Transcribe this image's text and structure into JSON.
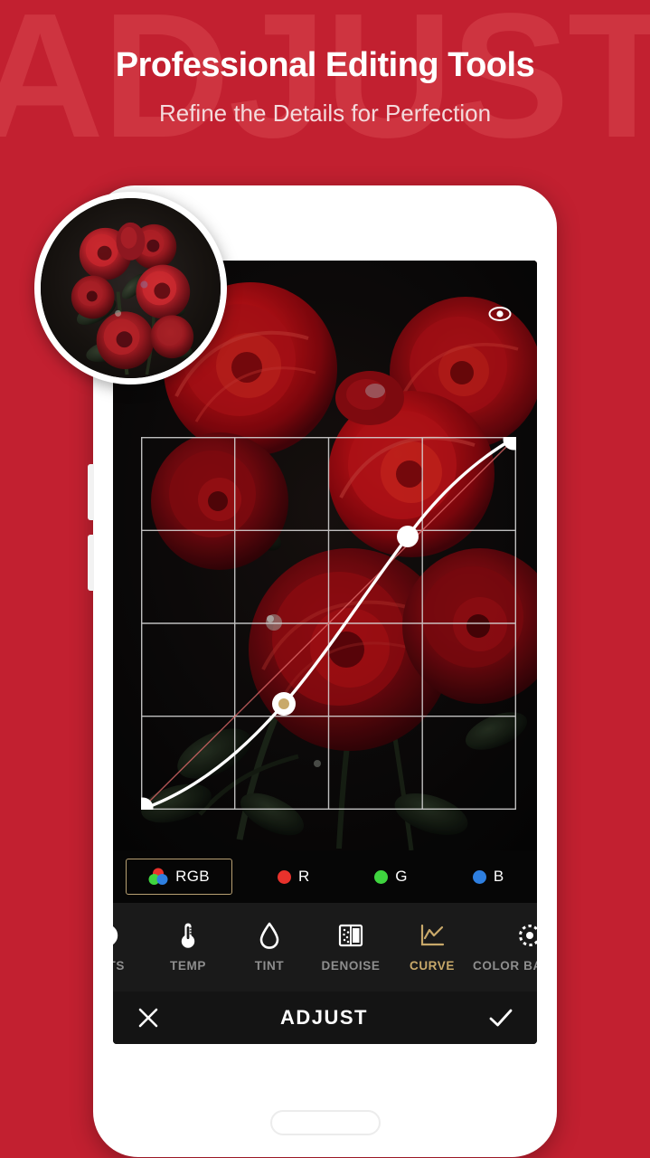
{
  "theme": {
    "brand_red": "#C22030",
    "watermark_red": "#CE3440",
    "accent_gold": "#C9A96A",
    "screen_black": "#0b0b0b",
    "bar_black": "#141414"
  },
  "header": {
    "watermark_text": "ADJUST",
    "title": "Professional Editing Tools",
    "subtitle": "Refine the Details for Perfection"
  },
  "phone": {
    "home_button": "home-button",
    "volume_up": "volume-up-button",
    "volume_down": "volume-down-button"
  },
  "thumbnail": {
    "alt": "original-photo-preview",
    "subject": "red roses bouquet on dark background"
  },
  "screen": {
    "preview_toggle_icon": "eye-icon",
    "photo_subject": "red roses bouquet on dark background"
  },
  "curve_editor": {
    "grid_rows": 4,
    "grid_columns": 4,
    "reference_line": "linear diagonal",
    "selected_point_index": 1,
    "points": [
      {
        "label": "shadows-anchor",
        "x": 0.0,
        "y": 0.0,
        "selected": false
      },
      {
        "label": "darks-point",
        "x": 0.38,
        "y": 0.26,
        "selected": true
      },
      {
        "label": "midtones-point",
        "x": 0.71,
        "y": 0.76,
        "selected": false
      },
      {
        "label": "highlights-anchor",
        "x": 1.0,
        "y": 1.0,
        "selected": false
      }
    ]
  },
  "channels": {
    "selected": "RGB",
    "items": [
      {
        "id": "rgb",
        "label": "RGB",
        "icon": "rgb-venn-icon",
        "color": "#ffffff",
        "selected": true
      },
      {
        "id": "r",
        "label": "R",
        "icon": "dot-icon",
        "color": "#E8322C",
        "selected": false
      },
      {
        "id": "g",
        "label": "G",
        "icon": "dot-icon",
        "color": "#3FD43F",
        "selected": false
      },
      {
        "id": "b",
        "label": "B",
        "icon": "dot-icon",
        "color": "#2E7FE0",
        "selected": false
      }
    ]
  },
  "tools": {
    "active": "CURVE",
    "items": [
      {
        "id": "highlights",
        "label": "GHTS",
        "icon": "highlights-icon",
        "active": false
      },
      {
        "id": "temp",
        "label": "TEMP",
        "icon": "thermometer-icon",
        "active": false
      },
      {
        "id": "tint",
        "label": "TINT",
        "icon": "droplet-icon",
        "active": false
      },
      {
        "id": "denoise",
        "label": "DENOISE",
        "icon": "denoise-icon",
        "active": false
      },
      {
        "id": "curve",
        "label": "CURVE",
        "icon": "curve-chart-icon",
        "active": true
      },
      {
        "id": "color_balance",
        "label": "COLOR BALANCE",
        "icon": "color-balance-icon",
        "active": false
      }
    ]
  },
  "action_bar": {
    "title": "ADJUST",
    "cancel_icon": "close-icon",
    "confirm_icon": "check-icon"
  }
}
